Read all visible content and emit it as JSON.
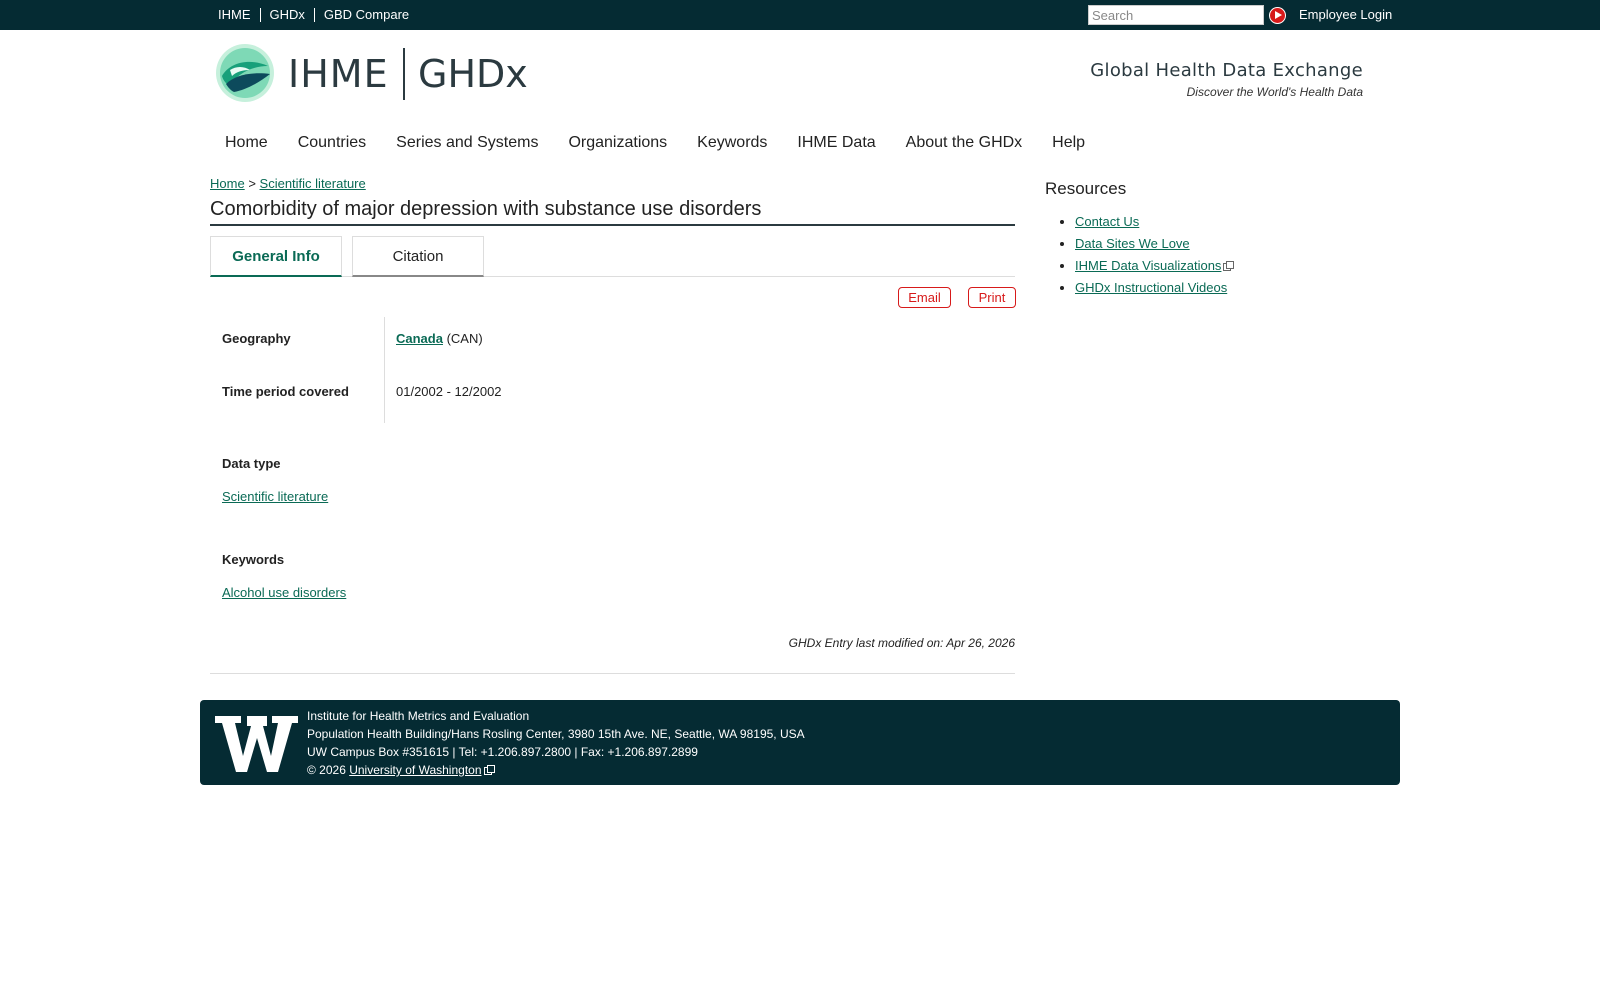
{
  "topbar": {
    "links": [
      "IHME",
      "GHDx",
      "GBD Compare"
    ],
    "search_placeholder": "Search",
    "employee_login": "Employee Login"
  },
  "header": {
    "logo_ihme": "IHME",
    "logo_ghdx": "GHDx",
    "tagline_title": "Global Health Data Exchange",
    "tagline_sub": "Discover the World's Health Data"
  },
  "nav": [
    "Home",
    "Countries",
    "Series and Systems",
    "Organizations",
    "Keywords",
    "IHME Data",
    "About the GHDx",
    "Help"
  ],
  "breadcrumb": {
    "home": "Home",
    "sep": ">",
    "current": "Scientific literature"
  },
  "page_title": "Comorbidity of major depression with substance use disorders",
  "tabs": [
    "General Info",
    "Citation"
  ],
  "actions": {
    "email": "Email",
    "print": "Print"
  },
  "info": {
    "geography_label": "Geography",
    "geography_link": "Canada",
    "geography_code": "(CAN)",
    "time_label": "Time period covered",
    "time_value": "01/2002 - 12/2002"
  },
  "data_type": {
    "label": "Data type",
    "value": "Scientific literature"
  },
  "keywords": {
    "label": "Keywords",
    "value": "Alcohol use disorders"
  },
  "modified": "GHDx Entry last modified on: Apr 26, 2026",
  "resources": {
    "title": "Resources",
    "items": [
      "Contact Us",
      "Data Sites We Love",
      "IHME Data Visualizations",
      "GHDx Instructional Videos"
    ]
  },
  "footer": {
    "line1": "Institute for Health Metrics and Evaluation",
    "line2": "Population Health Building/Hans Rosling Center, 3980 15th Ave. NE, Seattle, WA 98195, USA",
    "line3": "UW Campus Box #351615 | Tel: +1.206.897.2800 | Fax: +1.206.897.2899",
    "copyright": "© 2026",
    "uw_link": "University of Washington"
  },
  "colors": {
    "topbar": "#052b33",
    "link_green": "#0a6a55",
    "action_red": "#d71a1a"
  }
}
